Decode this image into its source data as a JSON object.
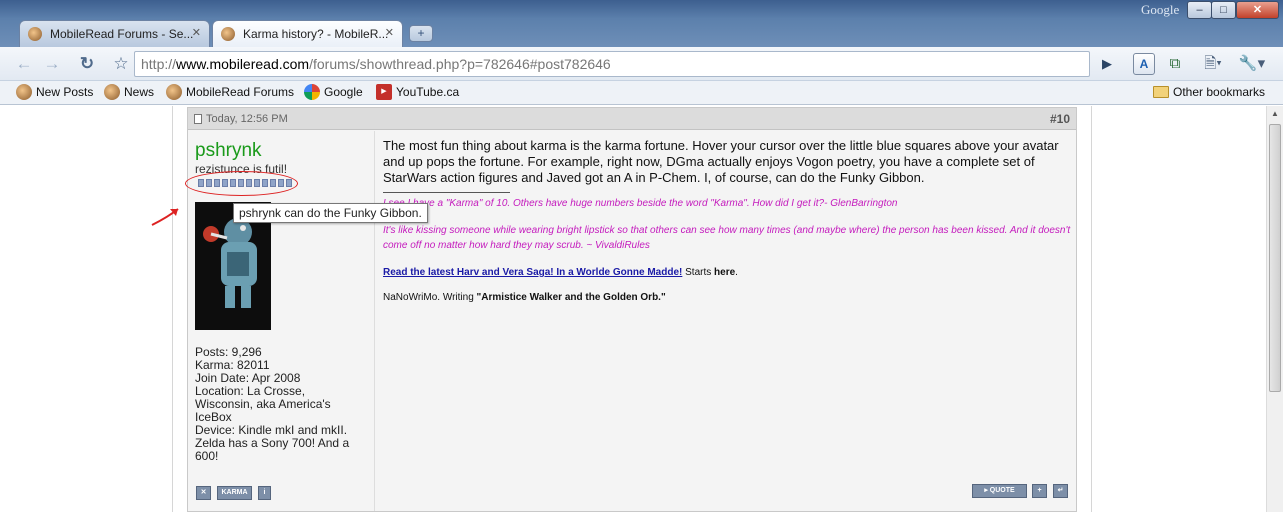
{
  "window": {
    "search_engine_label": "Google",
    "minimize": "–",
    "maximize": "□",
    "close": "✕"
  },
  "tabs": [
    {
      "label": "MobileRead Forums - Se...",
      "close": "✕"
    },
    {
      "label": "Karma history? - MobileR...",
      "close": "✕"
    }
  ],
  "new_tab": "+",
  "toolbar": {
    "url_prefix": "http://",
    "url_host": "www.mobileread.com",
    "url_path": "/forums/showthread.php?p=782646#post782646"
  },
  "bookmarks": {
    "items": [
      "New Posts",
      "News",
      "MobileRead Forums",
      "Google",
      "YouTube.ca"
    ],
    "other": "Other bookmarks"
  },
  "post": {
    "date": "Today, 12:56 PM",
    "number": "#10",
    "username": "pshrynk",
    "user_title": "rezistunce is futil!",
    "tooltip": "pshrynk can do the Funky Gibbon.",
    "karma_squares": 12,
    "stats": {
      "posts": "Posts: 9,296",
      "karma": "Karma: 82011",
      "join_date": "Join Date: Apr 2008",
      "location": "Location: La Crosse, Wisconsin, aka America's IceBox",
      "device": "Device: Kindle mkI and mkII. Zelda has a Sony 700! And a 600!"
    },
    "body": "The most fun thing about karma is the karma fortune. Hover your cursor over the little blue squares above your avatar and up pops the fortune. For example, right now, DGma actually enjoys Vogon poetry, you have a complete set of StarWars action figures and Javed got an A in P-Chem. I, of course, can do the Funky Gibbon.",
    "signature": {
      "quote1": "I see I have a \"Karma\" of 10. Others have huge numbers beside the word \"Karma\". How did I get it?- GlenBarrington",
      "quote2": "It's like kissing someone while wearing bright lipstick so that others can see how many times (and maybe where) the person has been kissed. And it doesn't come off no matter how hard they may scrub. ~ VivaldiRules",
      "link_text": "Read the latest Harv and Vera Saga! In a Worlde Gonne Madde!",
      "starts": " Starts ",
      "here": "here",
      "period": ".",
      "nanowrimo_prefix": "NaNoWriMo. Writing ",
      "nanowrimo_title": "\"Armistice Walker and the Golden Orb.\""
    },
    "buttons": {
      "report": "✕",
      "karma": "KARMA",
      "info": "i",
      "quote": "▸ QUOTE",
      "multiquote": "+",
      "reply": "↵"
    }
  }
}
